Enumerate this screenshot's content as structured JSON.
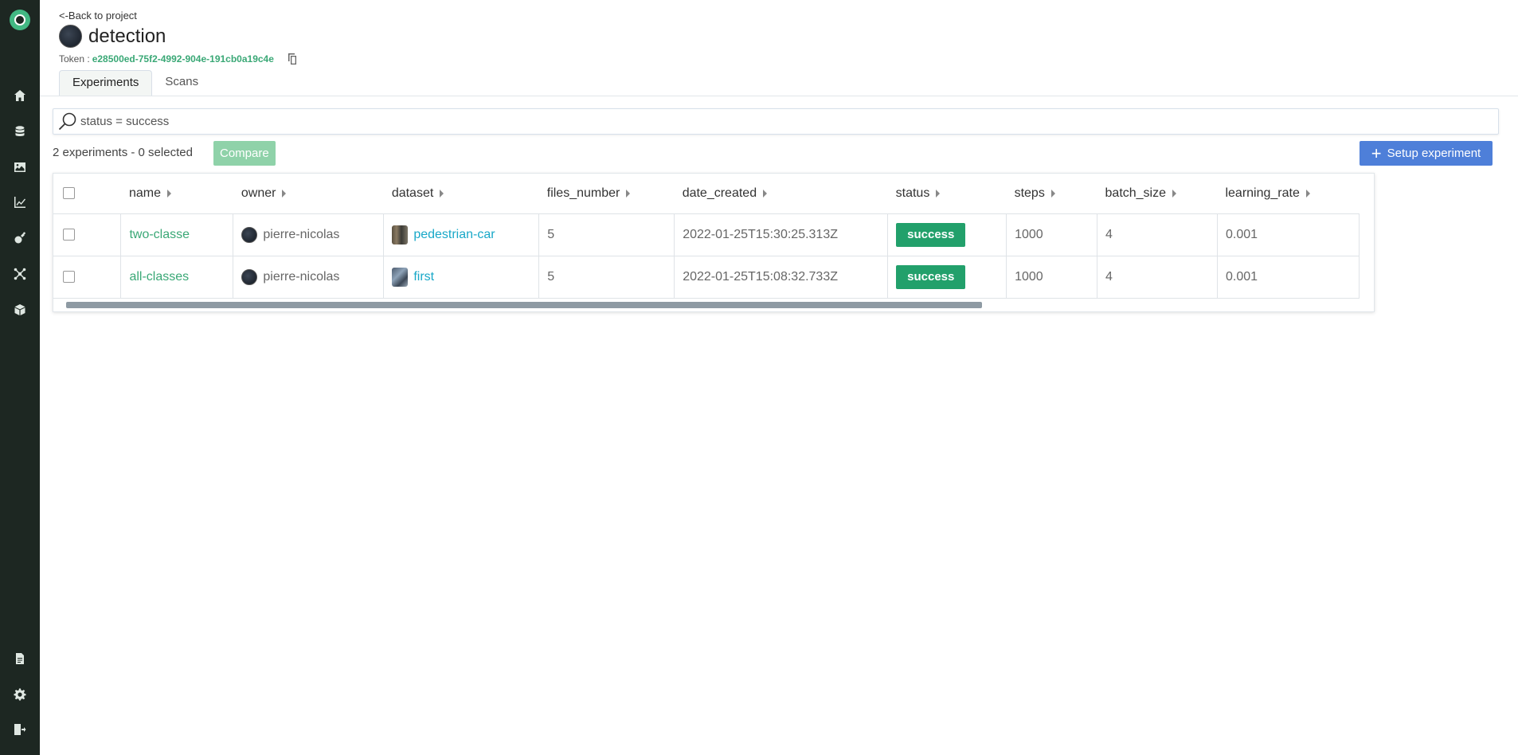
{
  "header": {
    "back_label": "<-Back to project",
    "project_title": "detection",
    "token_label": "Token :",
    "token_value": "e28500ed-75f2-4992-904e-191cb0a19c4e"
  },
  "tabs": [
    {
      "label": "Experiments",
      "active": true
    },
    {
      "label": "Scans",
      "active": false
    }
  ],
  "search": {
    "value": "status = success",
    "placeholder": ""
  },
  "toolbar": {
    "count_text": "2 experiments - 0 selected",
    "compare_label": "Compare",
    "setup_label": "Setup experiment"
  },
  "table": {
    "columns": [
      "name",
      "owner",
      "dataset",
      "files_number",
      "date_created",
      "status",
      "steps",
      "batch_size",
      "learning_rate"
    ],
    "rows": [
      {
        "name": "two-classe",
        "owner": "pierre-nicolas",
        "dataset": "pedestrian-car",
        "files_number": "5",
        "date_created": "2022-01-25T15:30:25.313Z",
        "status": "success",
        "steps": "1000",
        "batch_size": "4",
        "learning_rate": "0.001"
      },
      {
        "name": "all-classes",
        "owner": "pierre-nicolas",
        "dataset": "first",
        "files_number": "5",
        "date_created": "2022-01-25T15:08:32.733Z",
        "status": "success",
        "steps": "1000",
        "batch_size": "4",
        "learning_rate": "0.001"
      }
    ]
  },
  "sidebar": {
    "icons": [
      "home-icon",
      "database-icon",
      "image-icon",
      "chart-icon",
      "satellite-icon",
      "network-icon",
      "cube-icon",
      "document-icon",
      "gear-icon",
      "logout-icon"
    ]
  },
  "colors": {
    "sidebar_bg": "#1d2722",
    "accent_green": "#3aa876",
    "status_green": "#22a06b",
    "setup_blue": "#4e7fd9",
    "compare_disabled": "#8fd2a9",
    "dataset_link": "#18a8c8"
  }
}
